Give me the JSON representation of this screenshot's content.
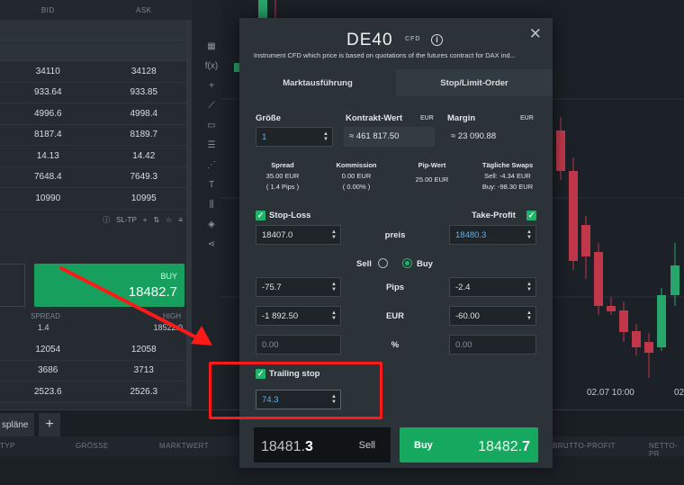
{
  "watchlist": {
    "col_bid": "BID",
    "col_ask": "ASK",
    "rows": [
      {
        "bid": "34110",
        "ask": "34128"
      },
      {
        "bid": "933.64",
        "ask": "933.85"
      },
      {
        "bid": "4996.6",
        "ask": "4998.4"
      },
      {
        "bid": "8187.4",
        "ask": "8189.7"
      },
      {
        "bid": "14.13",
        "ask": "14.42"
      },
      {
        "bid": "7648.4",
        "ask": "7649.3"
      },
      {
        "bid": "10990",
        "ask": "10995"
      }
    ],
    "sl_tp_label": "SL-TP",
    "buy_label": "BUY",
    "buy_price": "18482.7",
    "spread_label": "SPREAD",
    "spread_value": "1.4",
    "high_label": "HIGH",
    "high_value": "18522.0",
    "rows2": [
      {
        "bid": "12054",
        "ask": "12058"
      },
      {
        "bid": "3686",
        "ask": "3713"
      },
      {
        "bid": "2523.6",
        "ask": "2526.3"
      }
    ]
  },
  "bottom": {
    "tab_label": "spläne",
    "add_tab": "+",
    "columns": [
      "TYP",
      "GRÖSSE",
      "MARKTWERT",
      "BRUTTO-PROFIT",
      "NETTO-PR"
    ]
  },
  "chart": {
    "time_label": "02.07 10:00",
    "time_label2": "02"
  },
  "modal": {
    "title": "DE40",
    "badge": "CFD",
    "description": "Instrument CFD which price is based on quotations of the futures contract for DAX ind...",
    "tabs": [
      "Marktausführung",
      "Stop/Limit-Order"
    ],
    "size_label": "Größe",
    "size_value": "1",
    "contract_label": "Kontrakt-Wert",
    "contract_currency": "EUR",
    "contract_value": "≈ 461 817.50",
    "margin_label": "Margin",
    "margin_currency": "EUR",
    "margin_value": "≈ 23 090.88",
    "spread_label": "Spread",
    "spread_value": "35.00 EUR",
    "spread_pips": "( 1.4 Pips )",
    "commission_label": "Kommission",
    "commission_value": "0.00 EUR",
    "commission_pct": "( 0.00% )",
    "pip_label": "Pip-Wert",
    "pip_value": "25.00 EUR",
    "swaps_label": "Tägliche Swaps",
    "swaps_sell": "Sell: -4.34 EUR",
    "swaps_buy": "Buy: -98.30 EUR",
    "stop_loss_label": "Stop-Loss",
    "take_profit_label": "Take-Profit",
    "sl_price": "18407.0",
    "tp_price": "18480.3",
    "price_label": "preis",
    "sell_label": "Sell",
    "buy_label": "Buy",
    "sl_pips": "-75.7",
    "tp_pips": "-2.4",
    "pips_label": "Pips",
    "sl_eur": "-1 892.50",
    "tp_eur": "-60.00",
    "eur_label": "EUR",
    "sl_pct": "0.00",
    "tp_pct": "0.00",
    "pct_label": "%",
    "trailing_label": "Trailing stop",
    "trailing_value": "74.3",
    "sell_price_main": "18481.",
    "sell_price_big": "3",
    "sell_btn": "Sell",
    "buy_btn": "Buy",
    "buy_price_main": "18482.",
    "buy_price_big": "7",
    "close": "✕",
    "info": "i"
  },
  "colors": {
    "buy_green": "#17a85f",
    "checkbox_green": "#1fb46a",
    "highlight_red": "#ff1a1a",
    "candle_red": "#c0374a",
    "candle_green": "#28a56a"
  }
}
